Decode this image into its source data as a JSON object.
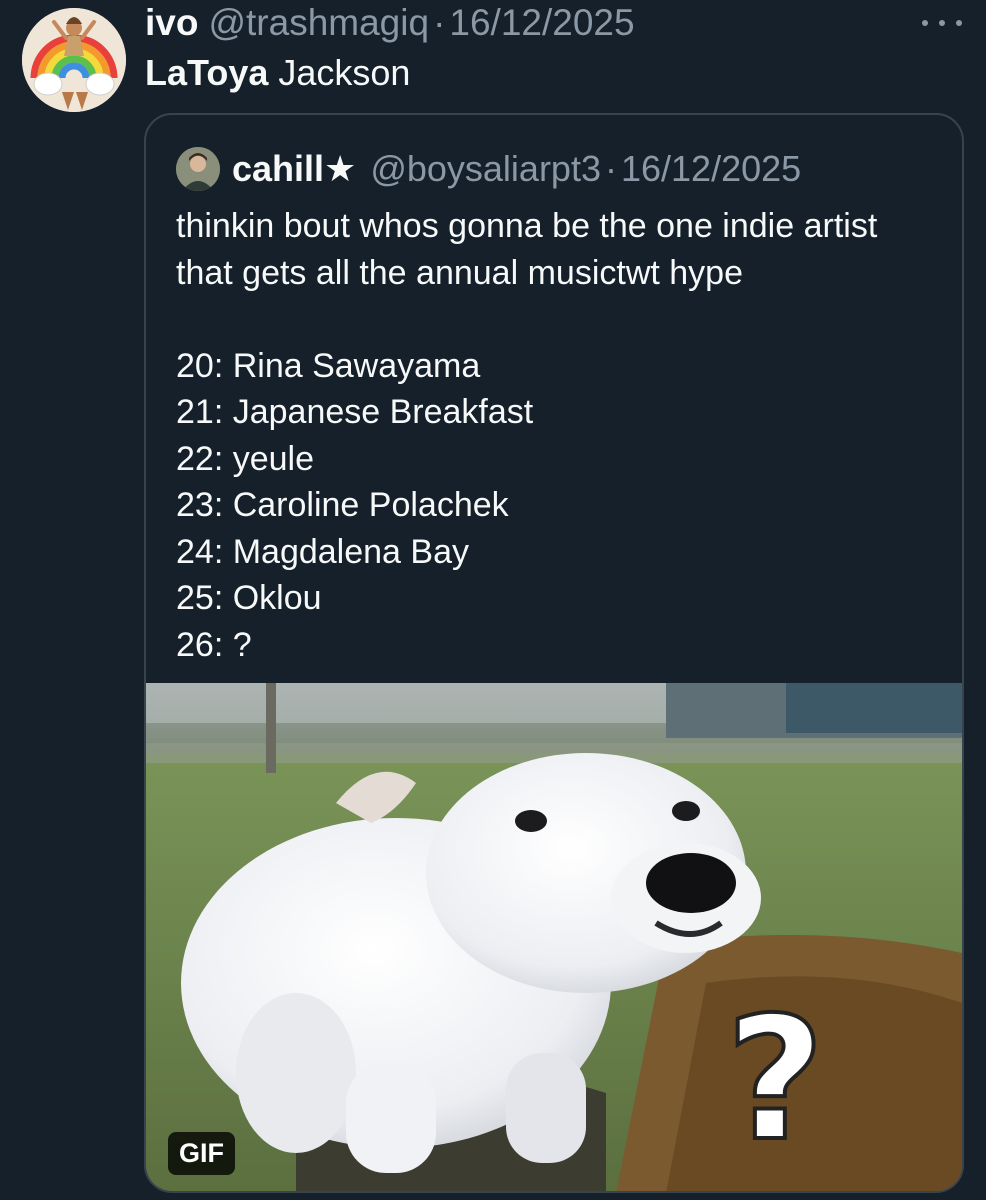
{
  "tweet": {
    "display_name": "ivo",
    "handle": "@trashmagiq",
    "separator": "·",
    "date": "16/12/2025",
    "text_bold": "LaToya",
    "text_rest": "Jackson",
    "more_icon": "more-horizontal-icon"
  },
  "quote": {
    "display_name": "cahill★",
    "handle": "@boysaliarpt3",
    "separator": "·",
    "date": "16/12/2025",
    "intro_lines": [
      "thinkin bout whos gonna be the one indie artist",
      "that gets all the annual musictwt hype"
    ],
    "list": [
      "20: Rina Sawayama",
      "21: Japanese Breakfast",
      "22: yeule",
      "23: Caroline Polachek",
      "24: Magdalena Bay",
      "25: Oklou",
      "26: ?"
    ],
    "media": {
      "badge": "GIF",
      "overlay_glyph": "?"
    }
  },
  "colors": {
    "background": "#15202b",
    "text_primary": "#f7f9f9",
    "text_secondary": "#8b98a5",
    "card_border": "#38444d"
  }
}
